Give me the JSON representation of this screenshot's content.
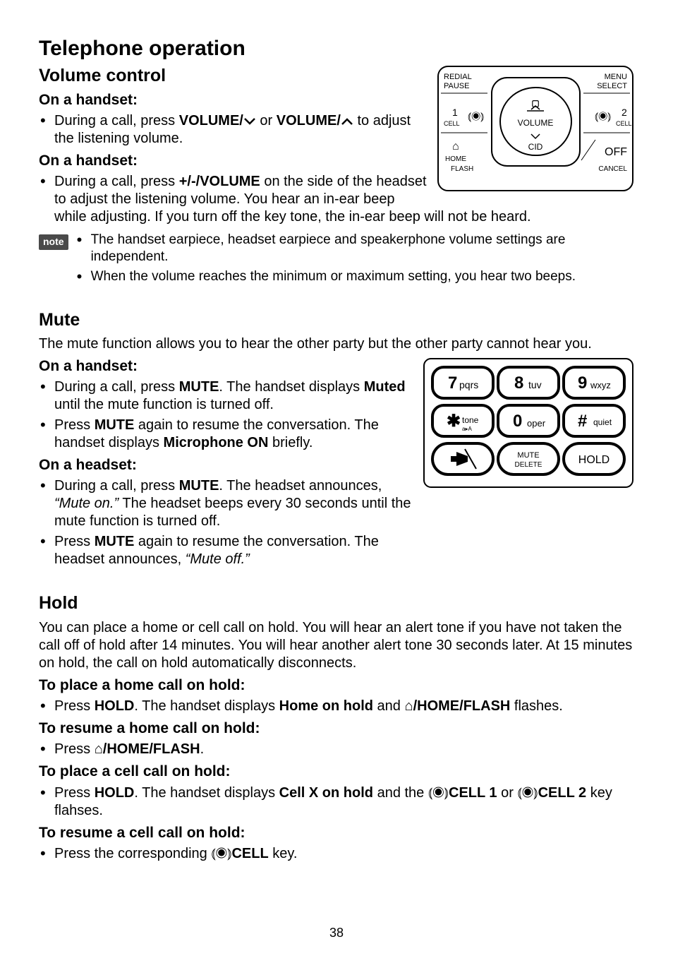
{
  "page": {
    "number": "38",
    "title": "Telephone operation"
  },
  "volume": {
    "heading": "Volume control",
    "sub1": "On a handset:",
    "item1_a": "During a call, press ",
    "item1_b": "VOLUME/",
    "item1_c": " or ",
    "item1_d": "VOLUME/",
    "item1_e": " to adjust the listening volume.",
    "sub2": "On a handset:",
    "item2_a": "During a call, press ",
    "item2_b": "+/-/VOLUME",
    "item2_c": " on the side of the headset to adjust the listening volume. You hear an in-ear beep while adjusting. If you turn off the key tone, the in-ear beep will not be heard.",
    "note_label": "note",
    "note1": "The handset earpiece, headset earpiece and speakerphone volume settings are independent.",
    "note2": "When the volume reaches the minimum or maximum setting, you hear two beeps."
  },
  "mute": {
    "heading": "Mute",
    "intro": "The mute function allows you to hear the other party but the other party cannot hear you.",
    "sub1": "On a handset:",
    "s1_i1_a": "During a call, press ",
    "s1_i1_b": "MUTE",
    "s1_i1_c": ". The handset displays ",
    "s1_i1_d": "Muted",
    "s1_i1_e": " until the mute function is turned off.",
    "s1_i2_a": "Press ",
    "s1_i2_b": "MUTE",
    "s1_i2_c": " again to resume the conversation. The handset displays ",
    "s1_i2_d": "Microphone ON",
    "s1_i2_e": " briefly.",
    "sub2": "On a headset:",
    "s2_i1_a": "During a call, press ",
    "s2_i1_b": "MUTE",
    "s2_i1_c": ". The headset announces, ",
    "s2_i1_d": "“Mute on.”",
    "s2_i1_e": " The headset beeps every 30 seconds until the mute function is turned off.",
    "s2_i2_a": "Press ",
    "s2_i2_b": "MUTE",
    "s2_i2_c": " again to resume the conversation. The headset announces, ",
    "s2_i2_d": "“Mute off.”"
  },
  "hold": {
    "heading": "Hold",
    "intro": "You can place a home or cell call on hold. You will hear an alert tone if you have not taken the call off of hold after 14 minutes. You will hear another alert tone 30 seconds later. At 15 minutes on hold, the call on hold automatically disconnects.",
    "sub1": "To place a home call on hold:",
    "i1_a": "Press ",
    "i1_b": "HOLD",
    "i1_c": ". The handset displays ",
    "i1_d": "Home on hold",
    "i1_e": " and ",
    "i1_f": "/HOME/FLASH",
    "i1_g": " flashes.",
    "sub2": "To resume a home call on hold:",
    "i2_a": "Press ",
    "i2_b": "/HOME/FLASH",
    "i2_c": ".",
    "sub3": "To place a cell call on hold:",
    "i3_a": "Press ",
    "i3_b": "HOLD",
    "i3_c": ". The handset displays ",
    "i3_d": "Cell X on hold",
    "i3_e": " and the ",
    "i3_f": "CELL 1",
    "i3_g": " or ",
    "i3_h": "CELL 2",
    "i3_i": " key flahses.",
    "sub4": "To resume a cell call on hold:",
    "i4_a": "Press the corresponding ",
    "i4_b": "CELL",
    "i4_c": " key."
  },
  "fig1": {
    "redial": "REDIAL",
    "pause": "PAUSE",
    "menu": "MENU",
    "select": "SELECT",
    "volume": "VOLUME",
    "cid": "CID",
    "cell1": "1",
    "cell1b": "CELL",
    "cell2": "2",
    "cell2b": "CELL",
    "home": "HOME",
    "flash": "FLASH",
    "off": "OFF",
    "cancel": "CANCEL"
  },
  "fig2": {
    "k7": "7",
    "k7b": "pqrs",
    "k8": "8",
    "k8b": "tuv",
    "k9": "9",
    "k9b": "wxyz",
    "star": "✱",
    "starb": "tone",
    "k0": "0",
    "k0b": "oper",
    "hash": "#",
    "hashb": "quiet",
    "mute": "MUTE",
    "muteb": "DELETE",
    "hold": "HOLD"
  }
}
